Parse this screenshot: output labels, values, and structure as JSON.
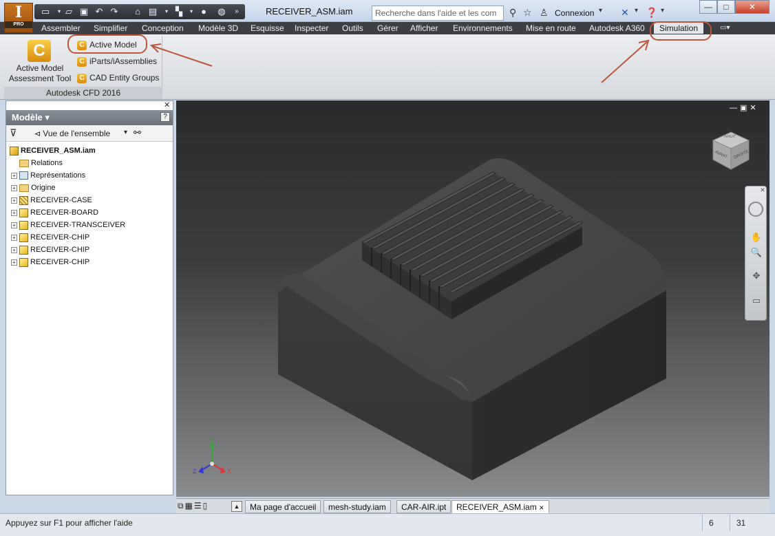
{
  "app": {
    "logo_letter": "I",
    "edition": "PRO",
    "document_title": "RECEIVER_ASM.iam"
  },
  "help": {
    "search_placeholder": "Recherche dans l'aide et les com",
    "login_label": "Connexion"
  },
  "ribbon": {
    "tabs": [
      "Assembler",
      "Simplifier",
      "Conception",
      "Modèle 3D",
      "Esquisse",
      "Inspecter",
      "Outils",
      "Gérer",
      "Afficher",
      "Environnements",
      "Mise en route",
      "Autodesk A360",
      "Simulation"
    ],
    "active_tab": "Simulation",
    "panel": {
      "big_button_line1": "Active Model",
      "big_button_line2": "Assessment Tool",
      "items": [
        "Active Model",
        "iParts/iAssemblies",
        "CAD Entity Groups"
      ],
      "footer": "Autodesk CFD 2016"
    }
  },
  "browser": {
    "title": "Modèle ▾",
    "view_label": "Vue de l'ensemble",
    "root": "RECEIVER_ASM.iam",
    "nodes": [
      "Relations",
      "Représentations",
      "Origine",
      "RECEIVER-CASE",
      "RECEIVER-BOARD",
      "RECEIVER-TRANSCEIVER",
      "RECEIVER-CHIP",
      "RECEIVER-CHIP",
      "RECEIVER-CHIP"
    ]
  },
  "viewcube": {
    "top": "HAUT",
    "front": "AVANT",
    "right": "DROITE"
  },
  "axes": {
    "x": "X",
    "y": "Y",
    "z": "Z"
  },
  "doc_tabs": [
    "Ma page d'accueil",
    "mesh-study.iam",
    "CAR-AIR.ipt",
    "RECEIVER_ASM.iam"
  ],
  "status": {
    "help_text": "Appuyez sur F1 pour afficher l'aide",
    "count1": "6",
    "count2": "31"
  },
  "colors": {
    "annotation": "#c0553a",
    "model": "#4a4b4d"
  }
}
